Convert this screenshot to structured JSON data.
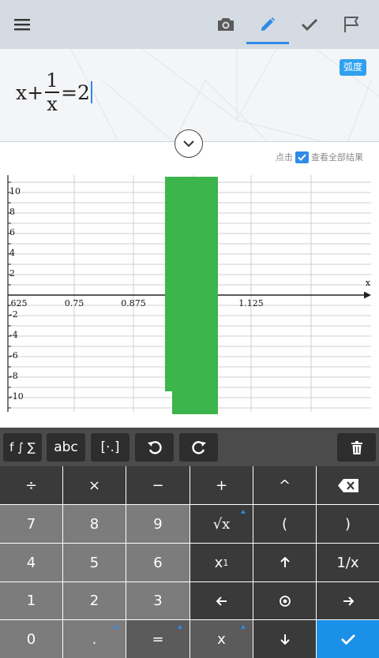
{
  "toolbar": {
    "icons": [
      "menu-icon",
      "camera-icon",
      "pencil-icon",
      "check-icon",
      "flag-icon"
    ],
    "active_tab": "pencil"
  },
  "expression": {
    "lhs_var": "x",
    "plus": "+",
    "numerator": "1",
    "denominator": "x",
    "equals": "=",
    "rhs": "2"
  },
  "angle_mode": "弧度",
  "show_all": {
    "prefix": "点击",
    "label": "查看全部结果"
  },
  "chart_data": {
    "type": "line",
    "x_ticks": [
      ".625",
      "0.75",
      "0.875",
      "1.125"
    ],
    "y_ticks": [
      "10",
      "8",
      "6",
      "4",
      "2",
      "-2",
      "-4",
      "-6",
      "-8",
      "-10"
    ],
    "x_label": "x",
    "series_color": "#3cb54c"
  },
  "keyboard": {
    "function_bar": [
      "f ∫ ∑",
      "abc",
      "[⋅.]"
    ],
    "keys": {
      "divide": "÷",
      "multiply": "×",
      "minus": "−",
      "plus": "+",
      "caret": "^",
      "seven": "7",
      "eight": "8",
      "nine": "9",
      "sqrt": "√x",
      "lparen": "(",
      "rparen": ")",
      "four": "4",
      "five": "5",
      "six": "6",
      "subscript": "x",
      "subscript_index": "1",
      "reciprocal": "1/x",
      "one": "1",
      "two": "2",
      "three": "3",
      "zero": "0",
      "dot": ".",
      "equals": "=",
      "var_x": "x"
    }
  },
  "colors": {
    "accent": "#2e8be8",
    "toolbar_bg": "#d5dbe2",
    "key_dark": "#3a3a3a",
    "key_light": "#7c7c7c",
    "enter_key": "#1b90e8"
  }
}
